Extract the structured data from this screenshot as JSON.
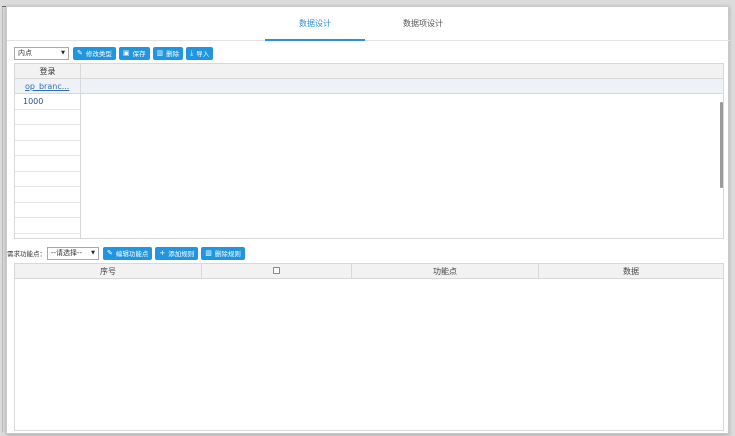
{
  "tabs": [
    {
      "label": "数据设计",
      "active": true
    },
    {
      "label": "数据项设计",
      "active": false
    }
  ],
  "toolbar1": {
    "type_select": {
      "value": "内点"
    },
    "buttons": [
      {
        "label": "修改类型",
        "icon": "edit-icon"
      },
      {
        "label": "保存",
        "icon": "save-icon"
      },
      {
        "label": "删除",
        "icon": "trash-icon"
      },
      {
        "label": "导入",
        "icon": "import-icon"
      }
    ]
  },
  "upper_table": {
    "header": "登录",
    "subheader": "op_branc...",
    "rows": [
      "1000",
      "",
      "",
      "",
      "",
      "",
      "",
      "",
      ""
    ]
  },
  "toolbar2": {
    "label": "需求功能点：",
    "select": {
      "value": "--请选择--"
    },
    "buttons": [
      {
        "label": "编辑功能点",
        "icon": "edit-icon"
      },
      {
        "label": "添加规则",
        "icon": "plus-icon"
      },
      {
        "label": "删除规则",
        "icon": "trash-icon"
      }
    ]
  },
  "lower_table": {
    "columns": [
      "序号",
      "",
      "功能点",
      "数据"
    ]
  },
  "colors": {
    "accent": "#2196e0",
    "tab_active": "#2d8fd6"
  }
}
